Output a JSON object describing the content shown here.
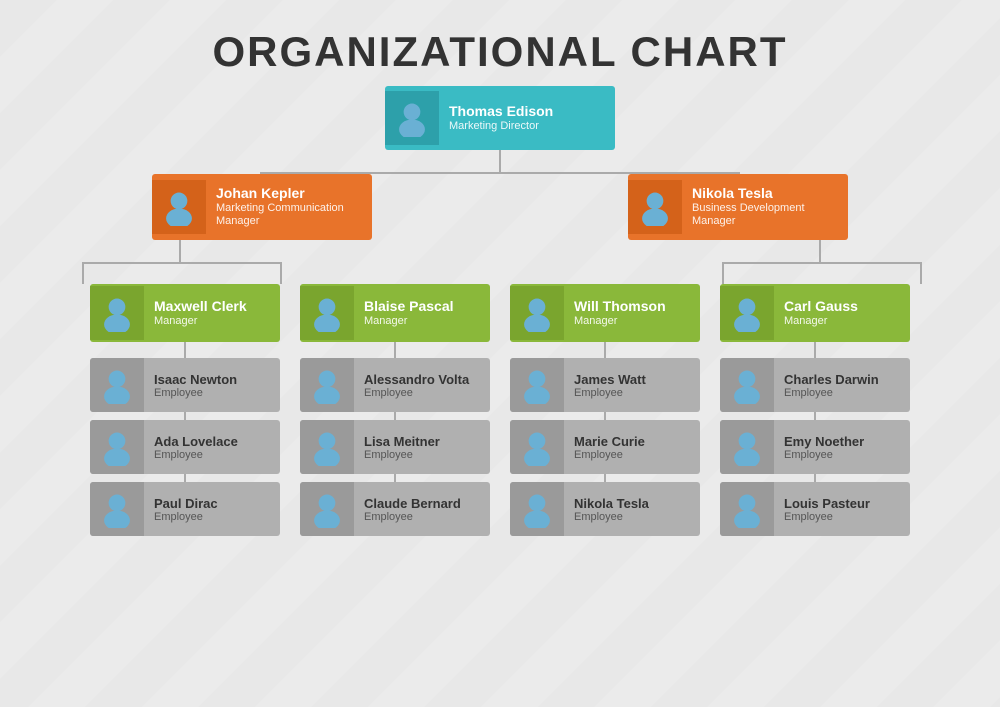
{
  "title": "ORGANIZATIONAL CHART",
  "top": {
    "name": "Thomas Edison",
    "title": "Marketing Director"
  },
  "level1": [
    {
      "name": "Johan Kepler",
      "title": "Marketing Communication Manager"
    },
    {
      "name": "Nikola Tesla",
      "title": "Business Development Manager"
    }
  ],
  "level2": [
    {
      "name": "Maxwell Clerk",
      "title": "Manager"
    },
    {
      "name": "Blaise Pascal",
      "title": "Manager"
    },
    {
      "name": "Will Thomson",
      "title": "Manager"
    },
    {
      "name": "Carl Gauss",
      "title": "Manager"
    }
  ],
  "employees": [
    [
      {
        "name": "Isaac Newton",
        "title": "Employee"
      },
      {
        "name": "Ada Lovelace",
        "title": "Employee"
      },
      {
        "name": "Paul Dirac",
        "title": "Employee"
      }
    ],
    [
      {
        "name": "Alessandro Volta",
        "title": "Employee"
      },
      {
        "name": "Lisa Meitner",
        "title": "Employee"
      },
      {
        "name": "Claude Bernard",
        "title": "Employee"
      }
    ],
    [
      {
        "name": "James Watt",
        "title": "Employee"
      },
      {
        "name": "Marie Curie",
        "title": "Employee"
      },
      {
        "name": "Nikola Tesla",
        "title": "Employee"
      }
    ],
    [
      {
        "name": "Charles Darwin",
        "title": "Employee"
      },
      {
        "name": "Emy Noether",
        "title": "Employee"
      },
      {
        "name": "Louis Pasteur",
        "title": "Employee"
      }
    ]
  ],
  "colors": {
    "teal": "#3abbc4",
    "orange": "#e8732a",
    "green": "#8ab83a",
    "gray": "#b0b0b0",
    "line": "#aaaaaa"
  }
}
